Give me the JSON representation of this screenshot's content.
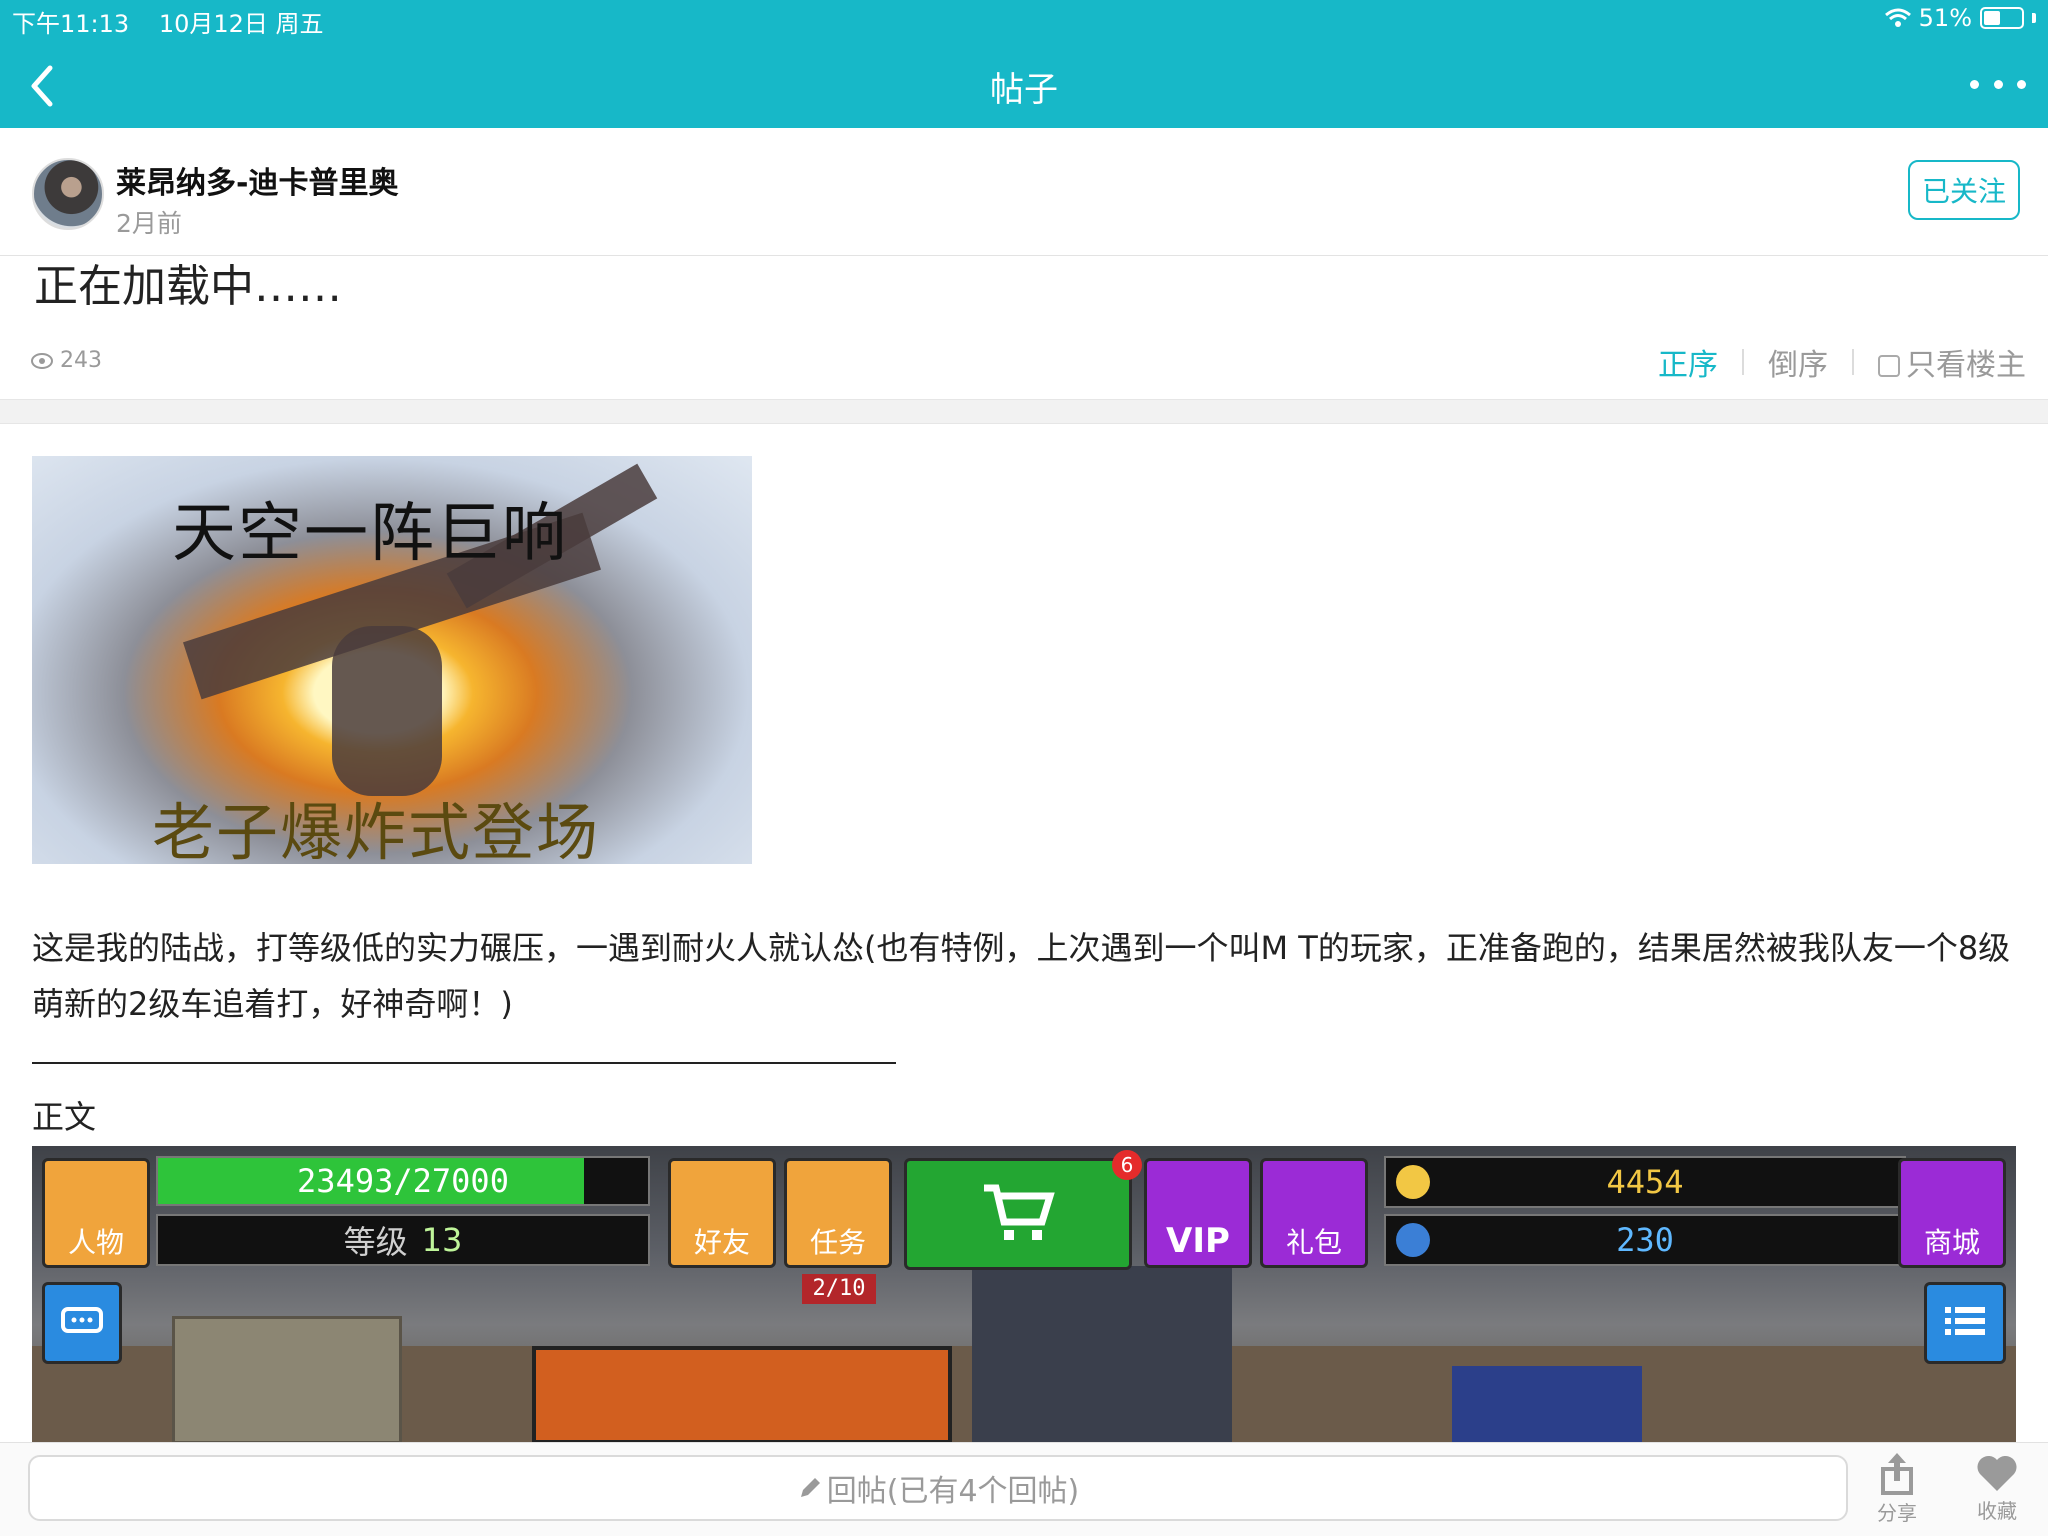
{
  "status": {
    "time": "下午11:13",
    "date": "10月12日 周五",
    "battery": "51%",
    "battery_level": 0.51
  },
  "nav": {
    "title": "帖子"
  },
  "author": {
    "name": "莱昂纳多-迪卡普里奥",
    "time": "2月前",
    "follow_label": "已关注"
  },
  "post": {
    "loading_text": "正在加载中……",
    "views": "243",
    "sort": {
      "forward": "正序",
      "reverse": "倒序",
      "owner_only": "只看楼主"
    },
    "image_caption_top": "天空一阵巨响",
    "image_caption_bottom": "老子爆炸式登场",
    "paragraph": "这是我的陆战，打等级低的实力碾压，一遇到耐火人就认怂(也有特例，上次遇到一个叫M T的玩家，正准备跑的，结果居然被我队友一个8级萌新的2级车追着打，好神奇啊！)",
    "section_label": "正文"
  },
  "game": {
    "xp": "23493/27000",
    "xp_progress": 0.87,
    "level_label": "等级",
    "level": "13",
    "tile_character": "人物",
    "tile_friends": "好友",
    "tile_tasks": "任务",
    "tasks_count": "2/10",
    "cart_badge": "6",
    "tile_vip": "VIP",
    "tile_gift": "礼包",
    "gold": "4454",
    "gems": "230",
    "tile_shop": "商城"
  },
  "bottom": {
    "reply_placeholder": "回帖(已有4个回帖)",
    "share_label": "分享",
    "favorite_label": "收藏"
  },
  "colors": {
    "accent": "#17b8c8",
    "muted": "#9a9a9a"
  }
}
